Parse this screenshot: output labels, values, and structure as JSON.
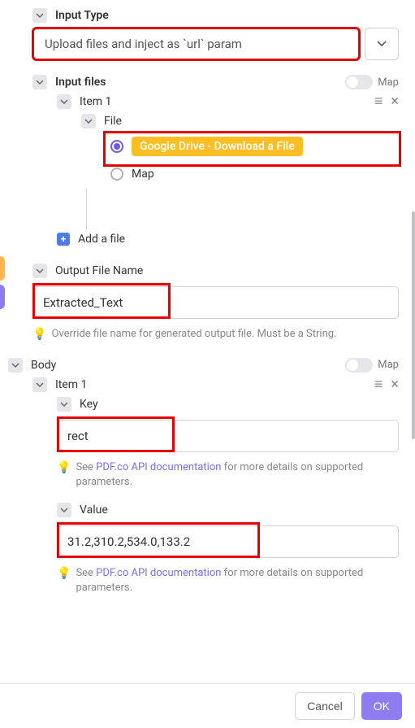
{
  "inputType": {
    "label": "Input Type",
    "value": "Upload files and inject as `url` param"
  },
  "inputFiles": {
    "label": "Input files",
    "mapLabel": "Map",
    "item": {
      "label": "Item 1",
      "fileLabel": "File",
      "options": {
        "selected": "Google Drive - Download a File",
        "map": "Map"
      }
    },
    "addFile": "Add a file"
  },
  "outputFileName": {
    "label": "Output File Name",
    "value": "Extracted_Text",
    "hint": "Override file name for generated output file. Must be a String."
  },
  "body": {
    "label": "Body",
    "mapLabel": "Map",
    "item": {
      "label": "Item 1",
      "key": {
        "label": "Key",
        "value": "rect",
        "hintPrefix": "See ",
        "hintLink": "PDF.co API documentation",
        "hintSuffix": " for more details on supported parameters."
      },
      "value": {
        "label": "Value",
        "value": "31.2,310.2,534.0,133.2",
        "hintPrefix": "See ",
        "hintLink": "PDF.co API documentation",
        "hintSuffix": " for more details on supported parameters."
      }
    }
  },
  "footer": {
    "cancel": "Cancel",
    "ok": "OK"
  }
}
